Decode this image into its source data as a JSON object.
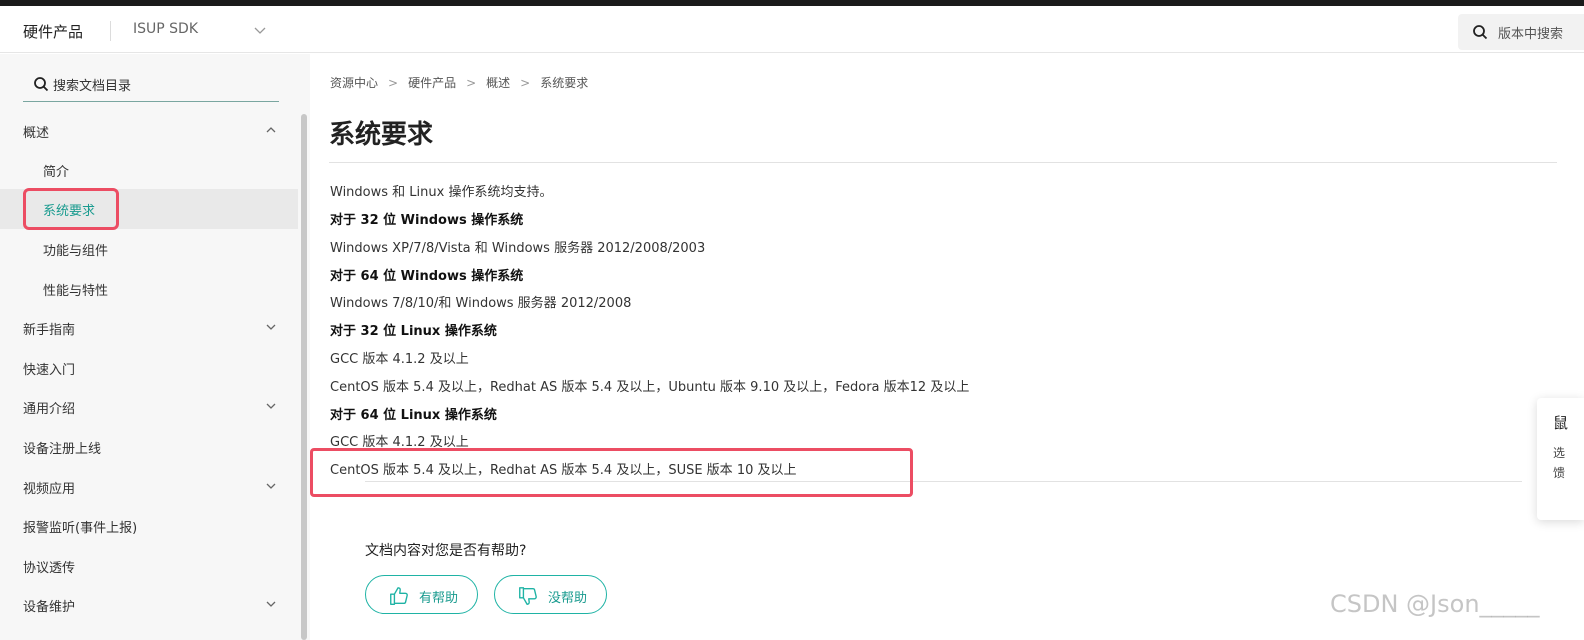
{
  "header": {
    "brand": "硬件产品",
    "product": "ISUP SDK",
    "search_placeholder": "版本中搜索"
  },
  "sidebar": {
    "search_placeholder": "搜索文档目录",
    "items": [
      {
        "label": "概述"
      },
      {
        "label": "简介"
      },
      {
        "label": "系统要求"
      },
      {
        "label": "功能与组件"
      },
      {
        "label": "性能与特性"
      },
      {
        "label": "新手指南"
      },
      {
        "label": "快速入门"
      },
      {
        "label": "通用介绍"
      },
      {
        "label": "设备注册上线"
      },
      {
        "label": "视频应用"
      },
      {
        "label": "报警监听(事件上报)"
      },
      {
        "label": "协议透传"
      },
      {
        "label": "设备维护"
      }
    ]
  },
  "breadcrumb": {
    "items": [
      "资源中心",
      "硬件产品",
      "概述",
      "系统要求"
    ],
    "separator": ">"
  },
  "page": {
    "title": "系统要求",
    "lines": [
      "Windows 和 Linux 操作系统均支持。",
      "对于 32 位 Windows 操作系统",
      "Windows XP/7/8/Vista 和 Windows 服务器 2012/2008/2003",
      "对于 64 位 Windows 操作系统",
      "Windows 7/8/10/和 Windows 服务器 2012/2008",
      "对于 32 位 Linux 操作系统",
      "GCC 版本 4.1.2 及以上",
      "CentOS 版本 5.4 及以上，Redhat AS 版本 5.4 及以上，Ubuntu 版本 9.10 及以上，Fedora 版本12 及以上",
      "对于 64 位 Linux 操作系统",
      "GCC 版本 4.1.2 及以上",
      "CentOS 版本 5.4 及以上，Redhat AS 版本 5.4 及以上，SUSE 版本 10 及以上"
    ]
  },
  "feedback": {
    "question": "文档内容对您是否有帮助?",
    "helpful": "有帮助",
    "not_helpful": "没帮助"
  },
  "float_card": {
    "line1": "鼠",
    "line2": "选",
    "line3": "馈"
  },
  "watermark": "CSDN @Json_____",
  "colors": {
    "accent": "#1a9b8f",
    "highlight_box": "#ec4d63"
  }
}
